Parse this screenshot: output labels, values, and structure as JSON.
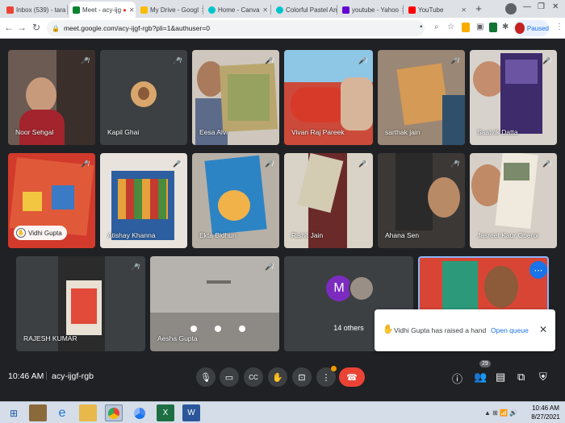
{
  "browser": {
    "tabs": [
      {
        "label": "Inbox (539) - tara",
        "icon": "gmail-icon",
        "color": "#ea4335"
      },
      {
        "label": "Meet - acy-ijg",
        "icon": "meet-icon",
        "color": "#00832d"
      },
      {
        "label": "My Drive - Googl",
        "icon": "drive-icon",
        "color": "#fbbc04"
      },
      {
        "label": "Home - Canva",
        "icon": "canva-icon",
        "color": "#00c4cc"
      },
      {
        "label": "Colorful Pastel An",
        "icon": "canva-icon",
        "color": "#00c4cc"
      },
      {
        "label": "youtube - Yahoo",
        "icon": "yahoo-icon",
        "color": "#6001d2"
      },
      {
        "label": "YouTube",
        "icon": "youtube-icon",
        "color": "#ff0000"
      }
    ],
    "url": "meet.google.com/acy-ijgf-rgb?pli=1&authuser=0",
    "profile_status": "Paused"
  },
  "meet": {
    "participants": [
      {
        "name": "Noor Sehgal"
      },
      {
        "name": "Kapil Ghai"
      },
      {
        "name": "Eesa Alvi"
      },
      {
        "name": "Vivan Raj Pareek"
      },
      {
        "name": "sarthak jain"
      },
      {
        "name": "Saatvik Datta"
      },
      {
        "name": "Vidhi Gupta"
      },
      {
        "name": "Atishay Khanna"
      },
      {
        "name": "Ekta Bidhuri"
      },
      {
        "name": "Rishit Jain"
      },
      {
        "name": "Ahana Sen"
      },
      {
        "name": "Jasreet Kaur Oberoi"
      },
      {
        "name": "RAJESH KUMAR"
      },
      {
        "name": "Aesha Gupta"
      }
    ],
    "others": {
      "avatar_letter": "M",
      "label": "14 others"
    },
    "notification": {
      "text": "Vidhi Gupta has raised a hand",
      "action": "Open queue"
    },
    "time": "10:46 AM",
    "meeting_code": "acy-ijgf-rgb",
    "people_count": "29"
  },
  "taskbar": {
    "clock_time": "10:46 AM",
    "clock_date": "8/27/2021"
  },
  "colors": {
    "meet_bg": "#202124",
    "tile_bg": "#3c4043",
    "end_call": "#ea4335",
    "accent_blue": "#1a73e8"
  }
}
